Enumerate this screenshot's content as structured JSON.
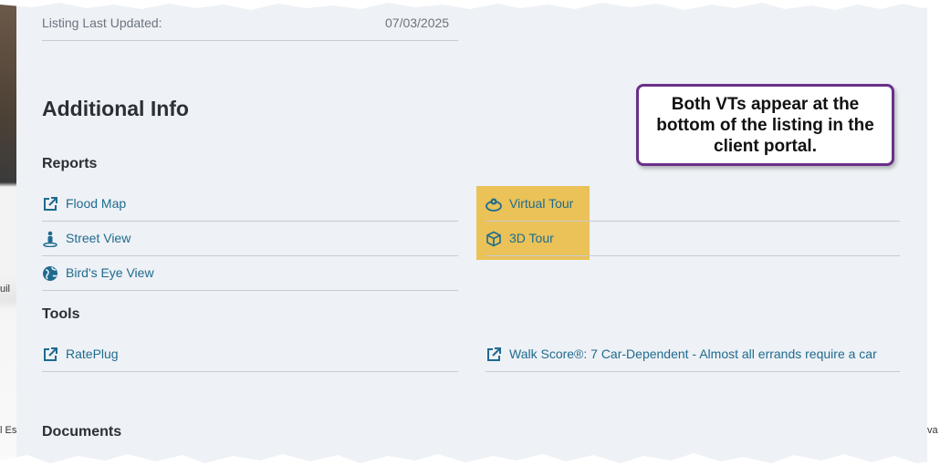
{
  "background": {
    "left_snippet_1": "uil",
    "left_snippet_2": "l Es",
    "right_snippet": "va"
  },
  "listing": {
    "updated_label": "Listing Last Updated:",
    "updated_value": "07/03/2025"
  },
  "additional_info": {
    "title": "Additional Info",
    "reports_heading": "Reports",
    "reports_left": [
      {
        "label": "Flood Map",
        "icon": "external-link-icon"
      },
      {
        "label": "Street View",
        "icon": "street-view-person-icon"
      },
      {
        "label": "Bird's Eye View",
        "icon": "globe-icon"
      }
    ],
    "reports_right": [
      {
        "label": "Virtual Tour",
        "icon": "panorama-icon"
      },
      {
        "label": "3D Tour",
        "icon": "cube-icon"
      }
    ],
    "tools_heading": "Tools",
    "tools_left": [
      {
        "label": "RatePlug",
        "icon": "external-link-icon"
      }
    ],
    "tools_right": [
      {
        "label": "Walk Score®: 7 Car-Dependent - Almost all errands require a car",
        "icon": "external-link-icon"
      }
    ],
    "documents_heading": "Documents"
  },
  "callout": {
    "text": "Both VTs appear at the bottom of the listing in the client portal.",
    "border_color": "#6a2f8a"
  },
  "colors": {
    "link": "#1e6b8f",
    "highlight": "#e9bf4f",
    "panel_bg": "#eef1f5"
  }
}
